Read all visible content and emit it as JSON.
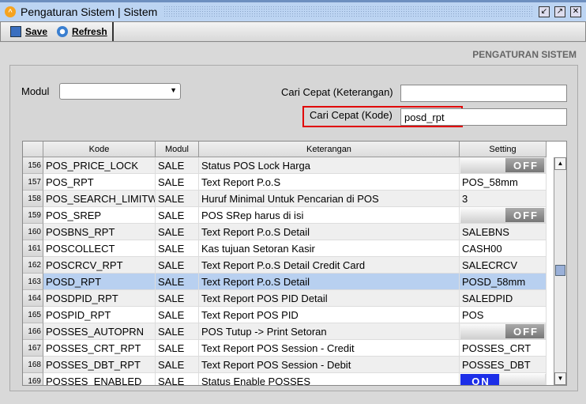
{
  "window": {
    "title": "Pengaturan Sistem | Sistem"
  },
  "toolbar": {
    "save_label": "Save",
    "refresh_label": "Refresh"
  },
  "page_title": "PENGATURAN SISTEM",
  "form": {
    "modul_label": "Modul",
    "modul_value": "",
    "cari_keterangan_label": "Cari Cepat (Keterangan)",
    "cari_keterangan_value": "",
    "cari_kode_label": "Cari Cepat (Kode)",
    "cari_kode_value": "posd_rpt"
  },
  "table": {
    "columns": [
      "Kode",
      "Modul",
      "Keterangan",
      "Setting"
    ],
    "selected_row": "163",
    "rows": [
      {
        "no": "156",
        "kode": "POS_PRICE_LOCK",
        "modul": "SALE",
        "ket": "Status POS Lock Harga",
        "setting": "OFF",
        "toggle": true
      },
      {
        "no": "157",
        "kode": "POS_RPT",
        "modul": "SALE",
        "ket": "Text Report P.o.S",
        "setting": "POS_58mm"
      },
      {
        "no": "158",
        "kode": "POS_SEARCH_LIMITW",
        "modul": "SALE",
        "ket": "Huruf Minimal Untuk Pencarian di POS",
        "setting": "3"
      },
      {
        "no": "159",
        "kode": "POS_SREP",
        "modul": "SALE",
        "ket": "POS SRep harus di isi",
        "setting": "OFF",
        "toggle": true
      },
      {
        "no": "160",
        "kode": "POSBNS_RPT",
        "modul": "SALE",
        "ket": "Text Report P.o.S Detail",
        "setting": "SALEBNS"
      },
      {
        "no": "161",
        "kode": "POSCOLLECT",
        "modul": "SALE",
        "ket": "Kas tujuan Setoran Kasir",
        "setting": "CASH00"
      },
      {
        "no": "162",
        "kode": "POSCRCV_RPT",
        "modul": "SALE",
        "ket": "Text Report P.o.S Detail Credit Card",
        "setting": "SALECRCV"
      },
      {
        "no": "163",
        "kode": "POSD_RPT",
        "modul": "SALE",
        "ket": "Text Report P.o.S Detail",
        "setting": "POSD_58mm"
      },
      {
        "no": "164",
        "kode": "POSDPID_RPT",
        "modul": "SALE",
        "ket": "Text Report POS PID Detail",
        "setting": "SALEDPID"
      },
      {
        "no": "165",
        "kode": "POSPID_RPT",
        "modul": "SALE",
        "ket": "Text Report POS PID",
        "setting": "POS"
      },
      {
        "no": "166",
        "kode": "POSSES_AUTOPRN",
        "modul": "SALE",
        "ket": "POS Tutup -> Print Setoran",
        "setting": "OFF",
        "toggle": true
      },
      {
        "no": "167",
        "kode": "POSSES_CRT_RPT",
        "modul": "SALE",
        "ket": "Text Report POS Session - Credit",
        "setting": "POSSES_CRT"
      },
      {
        "no": "168",
        "kode": "POSSES_DBT_RPT",
        "modul": "SALE",
        "ket": "Text Report POS Session - Debit",
        "setting": "POSSES_DBT"
      },
      {
        "no": "169",
        "kode": "POSSES_ENABLED",
        "modul": "SALE",
        "ket": "Status Enable POSSES",
        "setting": "ON",
        "toggle": true
      }
    ]
  },
  "colors": {
    "titlebar": "#bcd4f2",
    "selected_row": "#b8d0f0",
    "highlight_border": "#e00000",
    "toggle_on": "#1c2ee8"
  }
}
